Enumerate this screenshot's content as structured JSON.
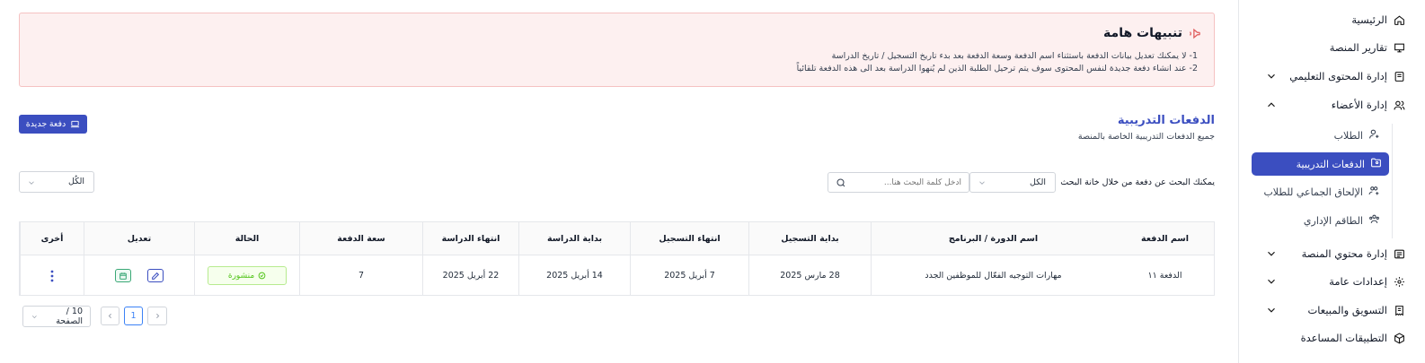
{
  "sidebar": {
    "items": [
      {
        "label": "الرئيسية",
        "icon": "home-icon"
      },
      {
        "label": "تقارير المنصة",
        "icon": "presentation-icon"
      },
      {
        "label": "إدارة المحتوى التعليمي",
        "icon": "book-icon"
      },
      {
        "label": "إدارة الأعضاء",
        "icon": "users-icon"
      },
      {
        "label": "إدارة محتوي المنصة",
        "icon": "list-icon"
      },
      {
        "label": "إعدادات عامة",
        "icon": "gear-icon"
      },
      {
        "label": "التسويق والمبيعات",
        "icon": "receipt-icon"
      },
      {
        "label": "التطبيقات المساعدة",
        "icon": "cube-icon"
      }
    ],
    "subitems": [
      {
        "label": "الطلاب",
        "icon": "user-plus-icon"
      },
      {
        "label": "الدفعات التدريبية",
        "icon": "folder-user-icon",
        "active": true
      },
      {
        "label": "الإلحاق الجماعي للطلاب",
        "icon": "users-plus-icon"
      },
      {
        "label": "الطاقم الإداري",
        "icon": "staff-icon"
      }
    ]
  },
  "alert": {
    "title": "تنبيهات هامة",
    "line1": "1- لا يمكنك تعديل بيانات الدفعة باستثناء اسم الدفعة وسعة الدفعة بعد بدء تاريخ التسجيل / تاريخ الدراسة",
    "line2": "2- عند انشاء دفعة جديدة لنفس المحتوى سوف يتم ترحيل الطلبة الذين لم يُنهوا الدراسة بعد الى هذه الدفعة تلقائياً"
  },
  "header": {
    "title": "الدفعات التدريبية",
    "subtitle": "جميع الدفعات التدريبية الخاصة بالمنصة",
    "new_button": "دفعة جديدة"
  },
  "search": {
    "hint": "يمكنك البحث عن دفعة من خلال خانة البحث",
    "scope_value": "الكل",
    "placeholder": "ادخل كلمة البحث هنا...",
    "filter_value": "الكُل"
  },
  "table": {
    "columns": [
      "اسم الدفعة",
      "اسم الدورة / البرنامج",
      "بداية التسجيل",
      "انتهاء التسجيل",
      "بداية الدراسة",
      "انتهاء الدراسة",
      "سعة الدفعة",
      "الحالة",
      "تعديل",
      "أخرى"
    ],
    "rows": [
      {
        "name": "الدفعة ١١",
        "course": "مهارات التوجيه الفعّال للموظفين الجدد",
        "reg_start": "28 مارس 2025",
        "reg_end": "7 أبريل 2025",
        "study_start": "14 أبريل 2025",
        "study_end": "22 أبريل 2025",
        "capacity": "7",
        "status": "منشورة"
      }
    ]
  },
  "pagination": {
    "current_page": "1",
    "page_size": "10 / الصفحة"
  },
  "colors": {
    "primary": "#3b4ec0",
    "alert_bg": "#fdf0f0",
    "alert_border": "#f5c2c2",
    "status_green": "#52c41a"
  }
}
